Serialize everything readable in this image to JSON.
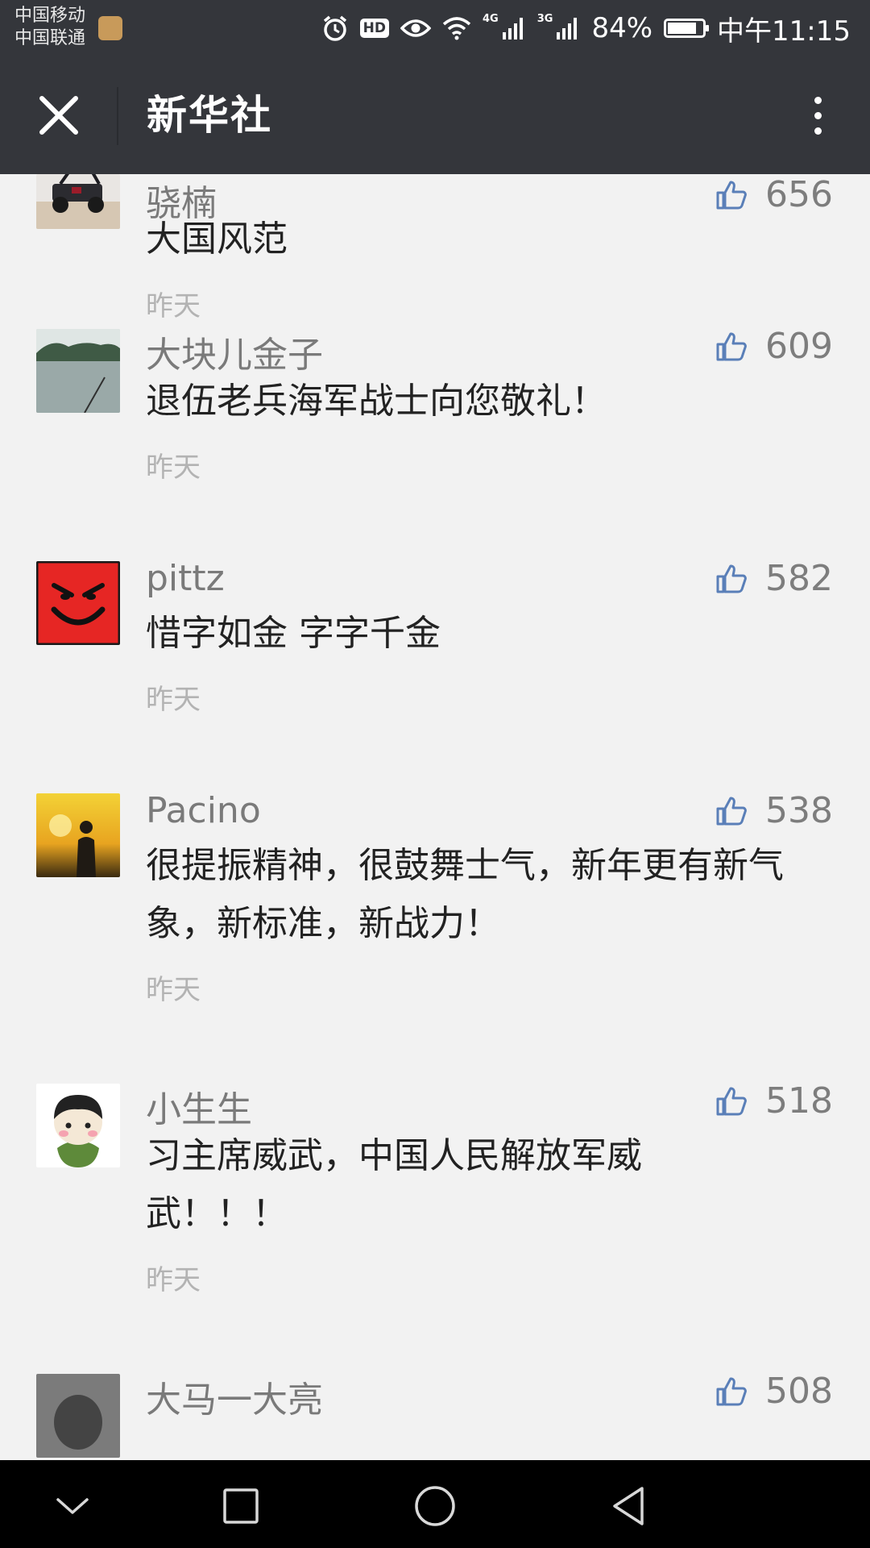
{
  "status_bar": {
    "carrier_1": "中国移动",
    "carrier_2": "中国联通",
    "hd_label": "HD",
    "net_4g": "4G",
    "net_3g": "3G",
    "battery_percent": "84%",
    "battery_level": 0.84,
    "time": "中午11:15"
  },
  "header": {
    "title": "新华社",
    "close_icon": "close-icon",
    "more_icon": "more-vertical-icon"
  },
  "comments": [
    {
      "author": "骁楠",
      "text": "大国风范",
      "time": "昨天",
      "likes": "656",
      "avatar": "avatar-offroad-vehicle"
    },
    {
      "author": "大块儿金子",
      "text": "退伍老兵海军战士向您敬礼！",
      "time": "昨天",
      "likes": "609",
      "avatar": "avatar-lake"
    },
    {
      "author": "pittz",
      "text": "惜字如金 字字千金",
      "time": "昨天",
      "likes": "582",
      "avatar": "avatar-red-smiley"
    },
    {
      "author": "Pacino",
      "text": "很提振精神，很鼓舞士气，新年更有新气象，新标准，新战力！",
      "time": "昨天",
      "likes": "538",
      "avatar": "avatar-sunset-man"
    },
    {
      "author": "小生生",
      "text": "习主席威武，中国人民解放军威武！！！",
      "time": "昨天",
      "likes": "518",
      "avatar": "avatar-cartoon-girl"
    },
    {
      "author": "大马一大亮",
      "text": "",
      "time": "",
      "likes": "508",
      "avatar": "avatar-gray"
    }
  ],
  "nav_bar": {
    "icons": [
      "chevron-down-icon",
      "square-icon",
      "circle-icon",
      "triangle-back-icon"
    ]
  }
}
